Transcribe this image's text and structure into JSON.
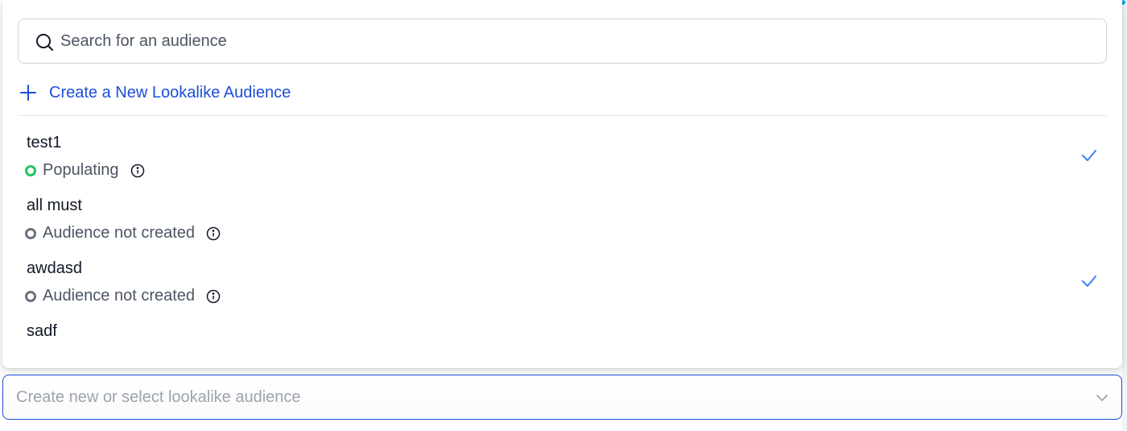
{
  "search": {
    "placeholder": "Search for an audience"
  },
  "create_action": {
    "label": "Create a New Lookalike Audience"
  },
  "audiences": [
    {
      "name": "test1",
      "status": "Populating",
      "status_color": "#22c55e",
      "selected": true
    },
    {
      "name": "all must",
      "status": "Audience not created",
      "status_color": "#6b7280",
      "selected": false
    },
    {
      "name": "awdasd",
      "status": "Audience not created",
      "status_color": "#6b7280",
      "selected": true
    },
    {
      "name": "sadf",
      "status": "",
      "selected": false
    }
  ],
  "select_field": {
    "placeholder": "Create new or select lookalike audience"
  },
  "colors": {
    "accent": "#1d4ed8",
    "check": "#3b82f6",
    "populating": "#22c55e",
    "not_created": "#6b7280"
  },
  "icons": {
    "search": "search-icon",
    "plus": "plus-icon",
    "info": "info-icon",
    "check": "check-icon",
    "chevron": "chevron-down-icon"
  }
}
